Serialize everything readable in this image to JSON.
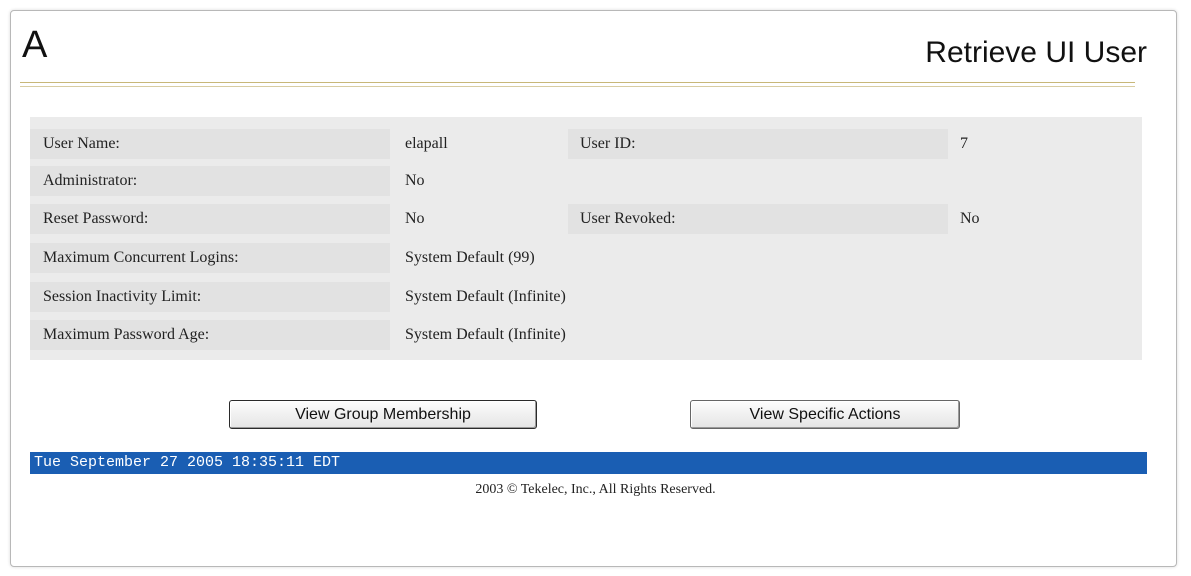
{
  "header": {
    "letter": "A",
    "title": "Retrieve UI User"
  },
  "user_info": {
    "user_name_label": "User Name:",
    "user_name_value": "elapall",
    "user_id_label": "User ID:",
    "user_id_value": "7",
    "administrator_label": "Administrator:",
    "administrator_value": "No",
    "reset_password_label": "Reset Password:",
    "reset_password_value": "No",
    "user_revoked_label": "User Revoked:",
    "user_revoked_value": "No",
    "max_logins_label": "Maximum Concurrent Logins:",
    "max_logins_value": "System Default (99)",
    "session_limit_label": "Session Inactivity Limit:",
    "session_limit_value": "System Default (Infinite)",
    "max_password_age_label": "Maximum Password Age:",
    "max_password_age_value": "System Default (Infinite)"
  },
  "actions": {
    "group_membership_label": "View Group Membership",
    "specific_actions_label": "View Specific Actions"
  },
  "status_bar": {
    "timestamp": "Tue September 27 2005 18:35:11 EDT"
  },
  "footer": {
    "copyright": "2003 © Tekelec, Inc., All Rights Reserved."
  },
  "colors": {
    "status_bar_bg": "#1a5eb3",
    "panel_bg": "#ebebeb",
    "rule_gold": "#c8b778"
  }
}
